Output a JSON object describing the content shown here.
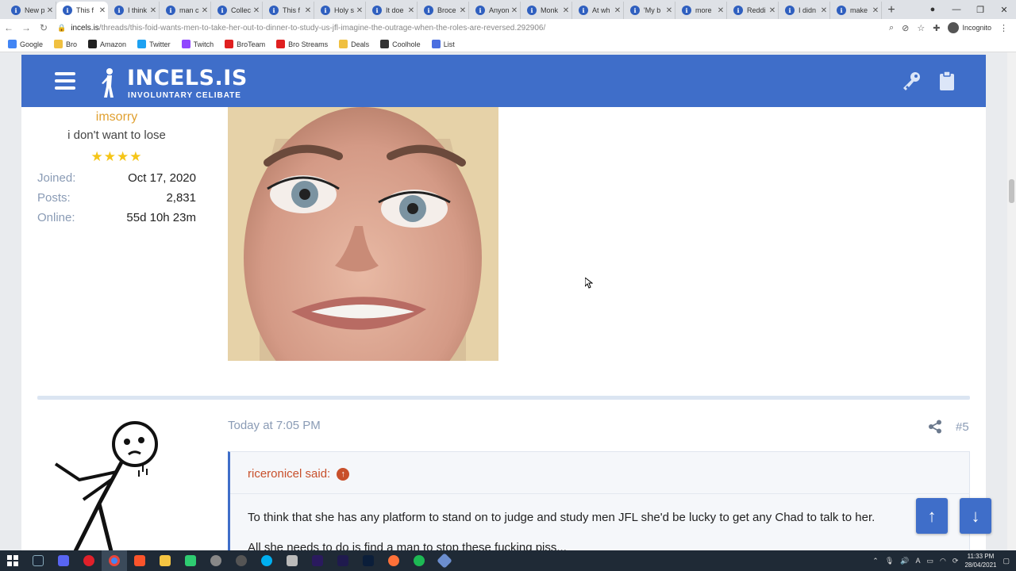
{
  "browser": {
    "tabs": [
      {
        "title": "New p",
        "active": false
      },
      {
        "title": "This f",
        "active": true
      },
      {
        "title": "I think",
        "active": false
      },
      {
        "title": "man c",
        "active": false
      },
      {
        "title": "Collec",
        "active": false
      },
      {
        "title": "This f",
        "active": false
      },
      {
        "title": "Holy s",
        "active": false
      },
      {
        "title": "It doe",
        "active": false
      },
      {
        "title": "Broce",
        "active": false
      },
      {
        "title": "Anyon",
        "active": false
      },
      {
        "title": "Monk",
        "active": false
      },
      {
        "title": "At wh",
        "active": false
      },
      {
        "title": "'My b",
        "active": false
      },
      {
        "title": "more",
        "active": false
      },
      {
        "title": "Reddi",
        "active": false
      },
      {
        "title": "I didn",
        "active": false
      },
      {
        "title": "make",
        "active": false
      }
    ],
    "url_host": "incels.is",
    "url_path": "/threads/this-foid-wants-men-to-take-her-out-to-dinner-to-study-us-jfl-imagine-the-outrage-when-the-roles-are-reversed.292906/",
    "profile_label": "Incognito",
    "bookmarks": [
      {
        "label": "Google",
        "color": "#4285f4"
      },
      {
        "label": "Bro",
        "color": "#f0c040"
      },
      {
        "label": "Amazon",
        "color": "#222222"
      },
      {
        "label": "Twitter",
        "color": "#1da1f2"
      },
      {
        "label": "Twitch",
        "color": "#9146ff"
      },
      {
        "label": "BroTeam",
        "color": "#e02020"
      },
      {
        "label": "Bro Streams",
        "color": "#e02020"
      },
      {
        "label": "Deals",
        "color": "#f0c040"
      },
      {
        "label": "Coolhole",
        "color": "#333333"
      },
      {
        "label": "List",
        "color": "#4a6ee0"
      }
    ]
  },
  "site": {
    "logo_name": "INCELS.IS",
    "logo_sub": "INVOLUNTARY CELIBATE",
    "accent": "#3f6ec9"
  },
  "post1": {
    "username": "imsorry",
    "user_title": "i don't want to lose",
    "stars": "★★★★",
    "stats": [
      {
        "key": "Joined:",
        "value": "Oct 17, 2020"
      },
      {
        "key": "Posts:",
        "value": "2,831"
      },
      {
        "key": "Online:",
        "value": "55d 10h 23m"
      }
    ]
  },
  "post2": {
    "date": "Today at 7:05 PM",
    "number": "#5",
    "quote_author": "riceronicel said:",
    "quote_text": "To think that she has any platform to stand on to judge and study men JFL she'd be lucky to get any Chad to talk to her.",
    "quote_text2": "All she needs to do is find a man to stop these fucking piss..."
  },
  "nav_buttons": {
    "up": "↑",
    "down": "↓"
  },
  "taskbar": {
    "time": "11:33 PM",
    "date": "28/04/2021"
  }
}
